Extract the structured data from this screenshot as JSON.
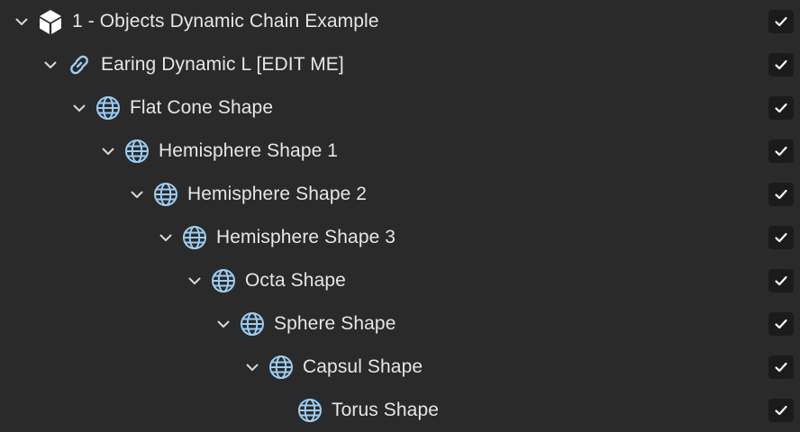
{
  "tree": {
    "rows": [
      {
        "label": "1 - Objects Dynamic Chain Example",
        "icon": "object-cube-icon",
        "expanded": true,
        "visible": true,
        "depth": 0
      },
      {
        "label": "Earing Dynamic L [EDIT ME]",
        "icon": "link-chain-icon",
        "expanded": true,
        "visible": true,
        "depth": 1
      },
      {
        "label": "Flat Cone Shape",
        "icon": "globe-shape-icon",
        "expanded": true,
        "visible": true,
        "depth": 2
      },
      {
        "label": "Hemisphere Shape 1",
        "icon": "globe-shape-icon",
        "expanded": true,
        "visible": true,
        "depth": 3
      },
      {
        "label": "Hemisphere Shape 2",
        "icon": "globe-shape-icon",
        "expanded": true,
        "visible": true,
        "depth": 4
      },
      {
        "label": "Hemisphere Shape 3",
        "icon": "globe-shape-icon",
        "expanded": true,
        "visible": true,
        "depth": 5
      },
      {
        "label": "Octa Shape",
        "icon": "globe-shape-icon",
        "expanded": true,
        "visible": true,
        "depth": 6
      },
      {
        "label": "Sphere Shape",
        "icon": "globe-shape-icon",
        "expanded": true,
        "visible": true,
        "depth": 7
      },
      {
        "label": "Capsul Shape",
        "icon": "globe-shape-icon",
        "expanded": true,
        "visible": true,
        "depth": 8
      },
      {
        "label": "Torus Shape",
        "icon": "globe-shape-icon",
        "expanded": false,
        "visible": true,
        "depth": 9
      }
    ]
  },
  "colors": {
    "background": "#2a2a2a",
    "text": "#e6e6e6",
    "shape_icon": "#9ccdf2",
    "checkbox_bg": "#1b1b1b",
    "checkmark": "#ffffff"
  }
}
